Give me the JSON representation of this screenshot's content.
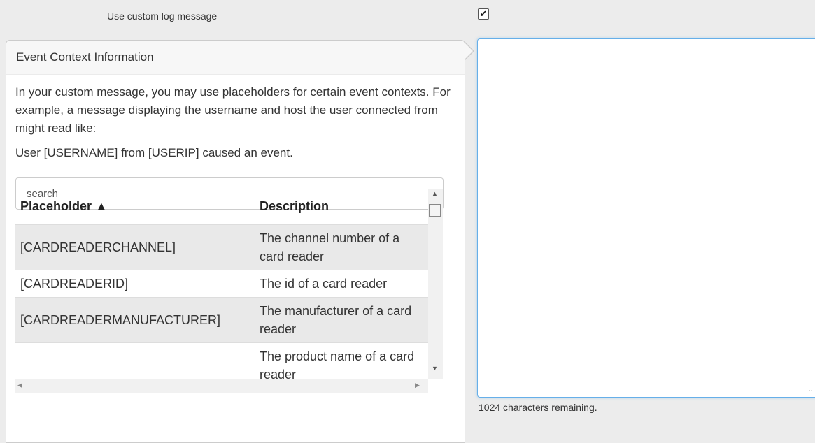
{
  "option": {
    "label": "Use custom log message",
    "checked": "✔"
  },
  "popover": {
    "title": "Event Context Information",
    "paragraph1": "In your custom message, you may use placeholders for certain event contexts. For example, a message displaying the username and host the user connected from might read like:",
    "paragraph2": "User [USERNAME] from [USERIP] caused an event.",
    "search_placeholder": "search",
    "table": {
      "col_placeholder": "Placeholder ▲",
      "col_description": "Description",
      "rows": [
        {
          "placeholder": "[CARDREADERCHANNEL]",
          "description": "The channel number of a card reader"
        },
        {
          "placeholder": "[CARDREADERID]",
          "description": "The id of a card reader"
        },
        {
          "placeholder": "[CARDREADERMANUFACTURER]",
          "description": "The manufacturer of a card reader"
        },
        {
          "placeholder": "",
          "description": "The product name of a card reader"
        }
      ]
    },
    "scroll": {
      "up": "▲",
      "down": "▼",
      "left": "◀",
      "right": "▶"
    }
  },
  "message": {
    "value": "",
    "remaining": "1024 characters remaining.",
    "grip": ".::"
  }
}
